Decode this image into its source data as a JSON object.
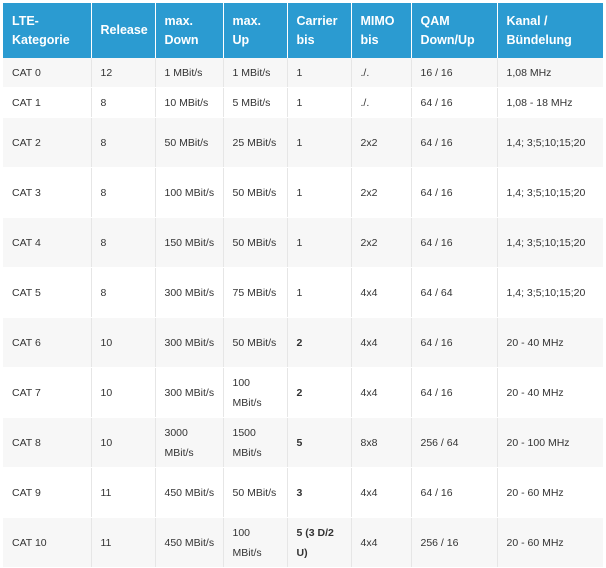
{
  "table": {
    "headers": [
      "LTE-\nKategorie",
      "Release",
      "max.\nDown",
      "max. Up",
      "Carrier\nbis",
      "MIMO\nbis",
      "QAM\nDown/Up",
      "Kanal /\nBündelung"
    ],
    "rows": [
      [
        "CAT 0",
        "12",
        "1 MBit/s",
        "1 MBit/s",
        "1",
        "./.",
        "16 / 16",
        "1,08 MHz"
      ],
      [
        "CAT 1",
        "8",
        "10 MBit/s",
        "5 MBit/s",
        "1",
        "./.",
        "64 / 16",
        "1,08 - 18 MHz"
      ],
      [
        "CAT 2",
        "8",
        "50 MBit/s",
        "25 MBit/s",
        "1",
        "2x2",
        "64 / 16",
        "1,4; 3;5;10;15;20"
      ],
      [
        "CAT 3",
        "8",
        "100 MBit/s",
        "50 MBit/s",
        "1",
        "2x2",
        "64 / 16",
        "1,4; 3;5;10;15;20"
      ],
      [
        "CAT 4",
        "8",
        "150 MBit/s",
        "50 MBit/s",
        "1",
        "2x2",
        "64 / 16",
        "1,4; 3;5;10;15;20"
      ],
      [
        "CAT 5",
        "8",
        "300 MBit/s",
        "75 MBit/s",
        "1",
        "4x4",
        "64 / 64",
        "1,4; 3;5;10;15;20"
      ],
      [
        "CAT 6",
        "10",
        "300 MBit/s",
        "50 MBit/s",
        "2",
        "4x4",
        "64 / 16",
        "20 - 40 MHz"
      ],
      [
        "CAT 7",
        "10",
        "300 MBit/s",
        "100 MBit/s",
        "2",
        "4x4",
        "64 / 16",
        "20 - 40 MHz"
      ],
      [
        "CAT 8",
        "10",
        "3000 MBit/s",
        "1500 MBit/s",
        "5",
        "8x8",
        "256 / 64",
        "20 - 100 MHz"
      ],
      [
        "CAT 9",
        "11",
        "450 MBit/s",
        "50 MBit/s",
        "3",
        "4x4",
        "64 / 16",
        "20 - 60 MHz"
      ],
      [
        "CAT 10",
        "11",
        "450 MBit/s",
        "100 MBit/s",
        "5 (3 D/2 U)",
        "4x4",
        "256 / 16",
        "20 - 60 MHz"
      ]
    ]
  },
  "colors": {
    "header_bg": "#2b9bd1",
    "header_text": "#ffffff",
    "row_odd": "#f7f7f7",
    "row_even": "#ffffff",
    "cell_text": "#333333"
  }
}
